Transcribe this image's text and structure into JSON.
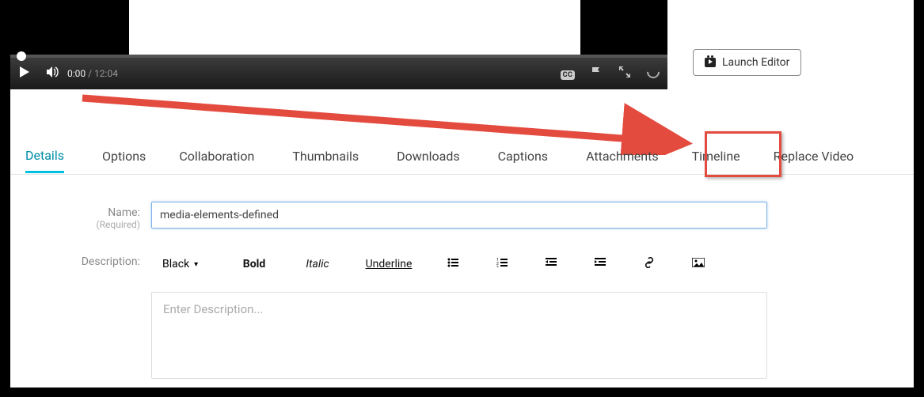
{
  "player": {
    "current_time": "0:00",
    "duration": "12:04",
    "cc_label": "CC",
    "icons": {
      "play": "play-icon",
      "volume": "volume-icon",
      "flag": "flag-icon",
      "fullscreen": "fullscreen-icon",
      "kaltura": "kaltura-logo-icon"
    }
  },
  "launch_editor_label": "Launch Editor",
  "tabs": [
    {
      "id": "details",
      "label": "Details",
      "active": true
    },
    {
      "id": "options",
      "label": "Options"
    },
    {
      "id": "collaboration",
      "label": "Collaboration"
    },
    {
      "id": "thumbnails",
      "label": "Thumbnails"
    },
    {
      "id": "downloads",
      "label": "Downloads"
    },
    {
      "id": "captions",
      "label": "Captions"
    },
    {
      "id": "attachments",
      "label": "Attachments"
    },
    {
      "id": "timeline",
      "label": "Timeline",
      "highlighted": true
    },
    {
      "id": "replace",
      "label": "Replace Video"
    }
  ],
  "form": {
    "name_label": "Name:",
    "name_required": "(Required)",
    "name_value": "media-elements-defined",
    "description_label": "Description:",
    "description_placeholder": "Enter Description...",
    "toolbar": {
      "color_label": "Black",
      "bold": "Bold",
      "italic": "Italic",
      "underline": "Underline"
    }
  },
  "annotation": {
    "arrow_color": "#e44b3f",
    "highlight_tab": "Timeline"
  }
}
